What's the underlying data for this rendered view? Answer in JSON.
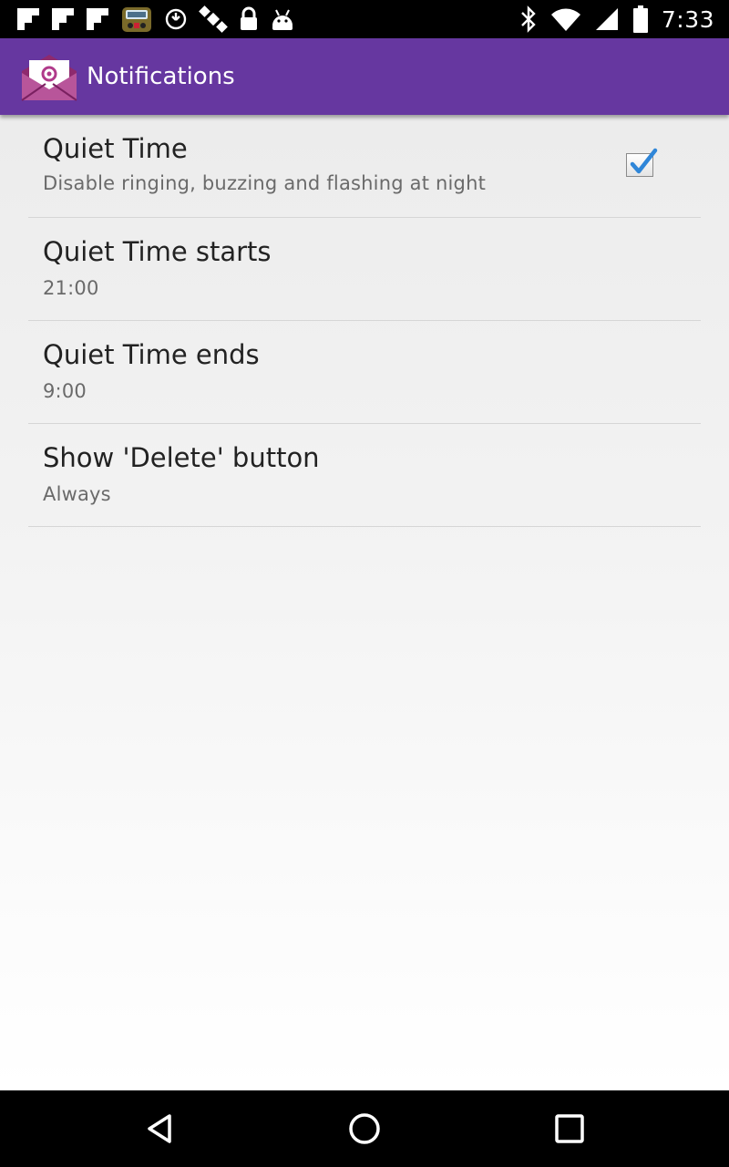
{
  "status_bar": {
    "time": "7:33",
    "left_icons": [
      "flipboard-icon",
      "flipboard-icon",
      "flipboard-icon",
      "radio-app-icon",
      "sync-icon",
      "gps-satellite-icon",
      "lock-icon",
      "android-icon"
    ],
    "right_icons": [
      "bluetooth-icon",
      "wifi-icon",
      "signal-icon",
      "battery-icon"
    ]
  },
  "action_bar": {
    "title": "Notifications",
    "background": "#6637a0"
  },
  "preferences": [
    {
      "title": "Quiet Time",
      "summary": "Disable ringing, buzzing and flashing at night",
      "has_checkbox": true,
      "checked": true
    },
    {
      "title": "Quiet Time starts",
      "summary": "21:00"
    },
    {
      "title": "Quiet Time ends",
      "summary": "9:00"
    },
    {
      "title": "Show 'Delete' button",
      "summary": "Always"
    }
  ],
  "nav_bar": {
    "buttons": [
      "back-icon",
      "home-icon",
      "recents-icon"
    ]
  },
  "colors": {
    "accent": "#6637a0",
    "check": "#2f86d8"
  }
}
